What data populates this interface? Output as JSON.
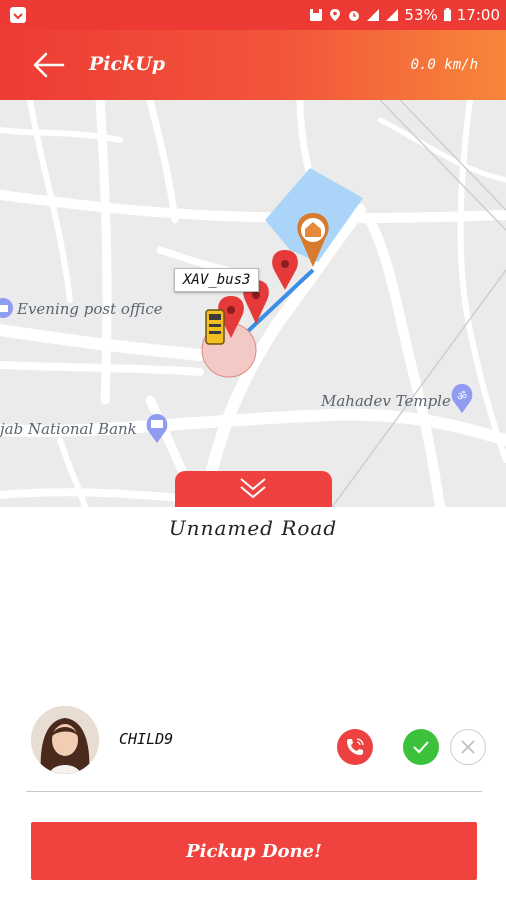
{
  "status_bar": {
    "battery": "53%",
    "time": "17:00"
  },
  "app_bar": {
    "title": "PickUp",
    "speed": "0.0 km/h"
  },
  "map": {
    "poi": [
      "Evening post office",
      "Mahadev Temple",
      "jab National Bank"
    ],
    "bus_label": "XAV_bus3"
  },
  "location": {
    "road_name": "Unnamed Road"
  },
  "child": {
    "name": "CHILD9"
  },
  "actions": {
    "pickup_done_label": "Pickup Done!"
  },
  "colors": {
    "primary": "#ee3b35",
    "accent_end": "#f7863a",
    "success": "#3cc23a"
  }
}
